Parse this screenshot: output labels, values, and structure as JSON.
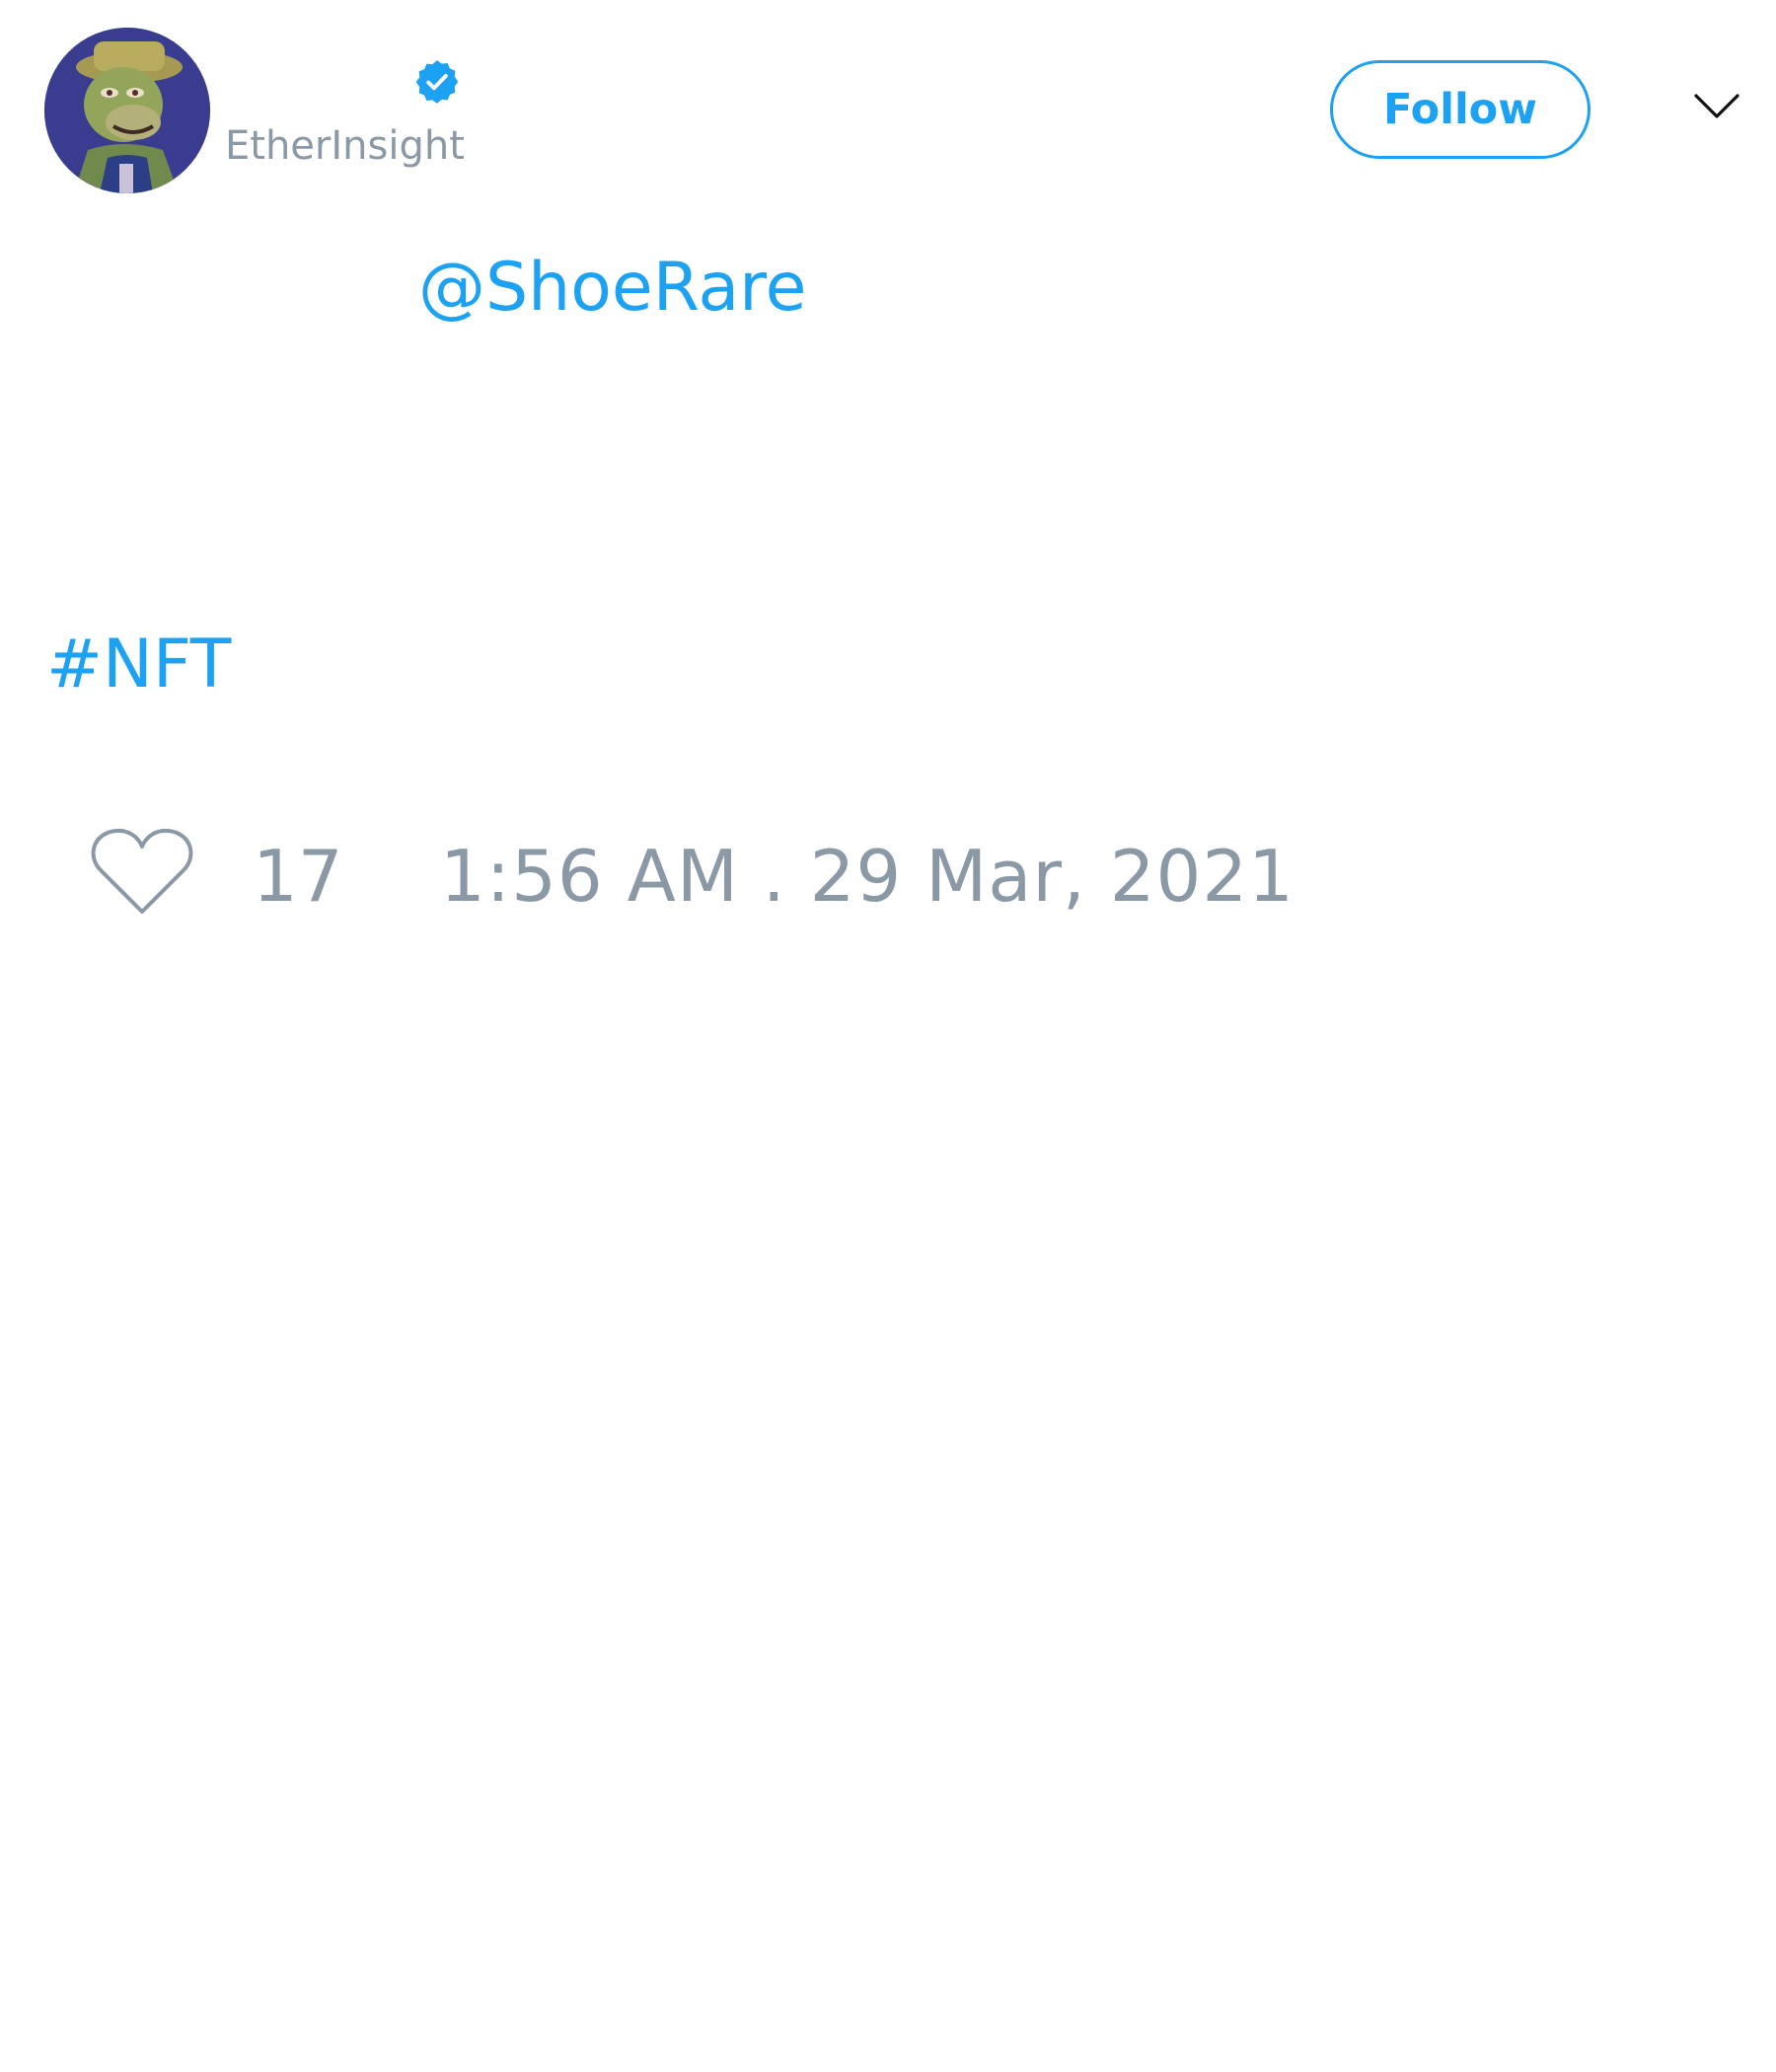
{
  "tweet": {
    "author": {
      "handle": "EtherInsight",
      "verified": true,
      "avatar": "ape-avatar"
    },
    "follow_label": "Follow",
    "menu_icon": "chevron-down-icon",
    "mention": "@ShoeRare",
    "hashtag": "#NFT",
    "like_icon": "heart-icon",
    "like_count": "17",
    "timestamp": "1:56 AM . 29 Mar, 2021"
  },
  "colors": {
    "accent": "#1da1f2",
    "muted": "#8b98a5",
    "background": "#ffffff"
  }
}
